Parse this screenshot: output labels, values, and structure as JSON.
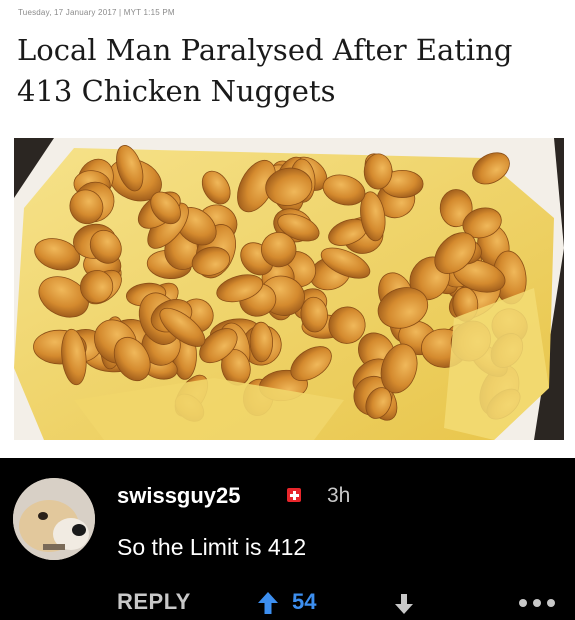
{
  "article": {
    "dateline": "Tuesday, 17 January 2017 | MYT 1:15 PM",
    "headline": "Local Man Paralysed After Eating 413 Chicken Nuggets"
  },
  "comment": {
    "username": "swissguy25",
    "flag_icon": "swiss-flag-icon",
    "time": "3h",
    "text": "So the Limit is 412",
    "reply_label": "REPLY",
    "score": "54",
    "upvote_color": "#3d8ff0",
    "icons": [
      "upvote-arrow-icon",
      "downvote-arrow-icon",
      "more-dots-icon"
    ]
  },
  "colors": {
    "comment_background": "#000000",
    "article_background": "#ffffff",
    "swiss_red": "#e8262b"
  }
}
